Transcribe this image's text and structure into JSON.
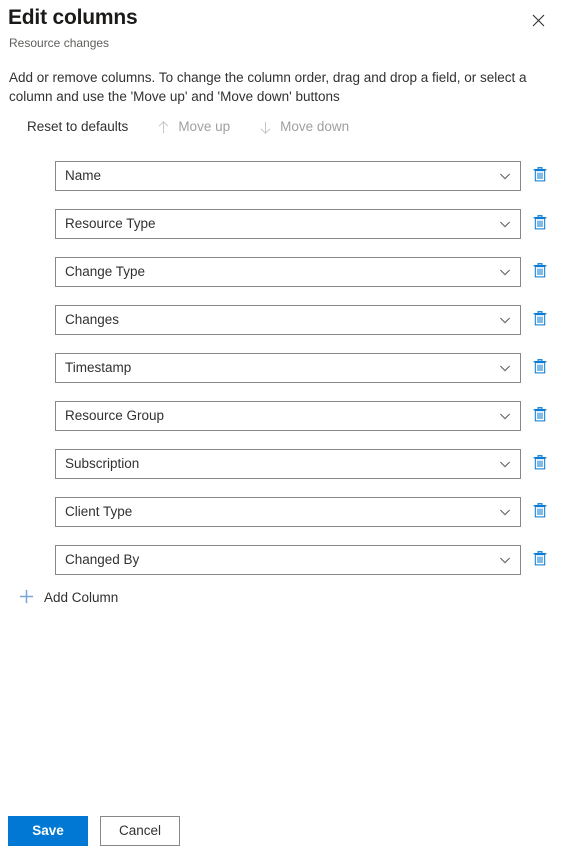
{
  "panel": {
    "title": "Edit columns",
    "subtitle": "Resource changes",
    "description": "Add or remove columns. To change the column order, drag and drop a field, or select a column and use the 'Move up' and 'Move down' buttons",
    "close_icon": "close-icon"
  },
  "commandbar": {
    "reset": {
      "label": "Reset to defaults",
      "disabled": false
    },
    "move_up": {
      "label": "Move up",
      "icon": "arrow-up-icon",
      "disabled": true
    },
    "move_down": {
      "label": "Move down",
      "icon": "arrow-down-icon",
      "disabled": true
    }
  },
  "columns": [
    {
      "value": "Name",
      "chevron_icon": "chevron-down-icon",
      "delete_icon": "trash-icon"
    },
    {
      "value": "Resource Type",
      "chevron_icon": "chevron-down-icon",
      "delete_icon": "trash-icon"
    },
    {
      "value": "Change Type",
      "chevron_icon": "chevron-down-icon",
      "delete_icon": "trash-icon"
    },
    {
      "value": "Changes",
      "chevron_icon": "chevron-down-icon",
      "delete_icon": "trash-icon"
    },
    {
      "value": "Timestamp",
      "chevron_icon": "chevron-down-icon",
      "delete_icon": "trash-icon"
    },
    {
      "value": "Resource Group",
      "chevron_icon": "chevron-down-icon",
      "delete_icon": "trash-icon"
    },
    {
      "value": "Subscription",
      "chevron_icon": "chevron-down-icon",
      "delete_icon": "trash-icon"
    },
    {
      "value": "Client Type",
      "chevron_icon": "chevron-down-icon",
      "delete_icon": "trash-icon"
    },
    {
      "value": "Changed By",
      "chevron_icon": "chevron-down-icon",
      "delete_icon": "trash-icon"
    }
  ],
  "add_column": {
    "label": "Add Column",
    "icon": "plus-icon"
  },
  "footer": {
    "save_label": "Save",
    "cancel_label": "Cancel"
  },
  "colors": {
    "accent": "#0078d4",
    "icon_blue": "#0078d4",
    "plus_blue": "#7aa6d6",
    "text": "#323130",
    "muted_text": "#605e5c",
    "disabled_text": "#a19f9d",
    "border": "#8a8886"
  }
}
